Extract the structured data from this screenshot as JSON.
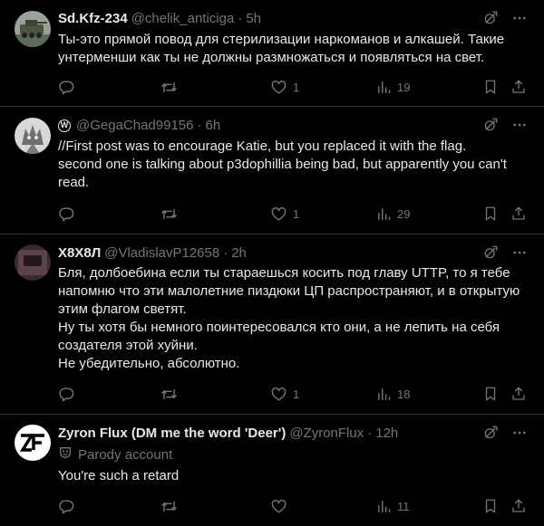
{
  "tweets": [
    {
      "username": "Sd.Kfz-234",
      "handle": "@chelik_anticiga",
      "sep": "·",
      "time": "5h",
      "text": "Ты-это прямой повод для стерилизации наркоманов и алкашей. Такие\nунтерменши как ты не должны размножаться и появляться на свет.",
      "likes": "1",
      "views": "19"
    },
    {
      "badge": "W",
      "handle": "@GegaChad99156",
      "sep": "·",
      "time": "6h",
      "text": "//First post was to encourage Katie, but you replaced it with the flag.\nsecond one is talking about p3dophillia being bad, but apparently you can't\nread.",
      "likes": "1",
      "views": "29"
    },
    {
      "username": "Х8Х8Л",
      "handle": "@VladislavP12658",
      "sep": "·",
      "time": "2h",
      "text": "Бля, долбоебина если ты стараешься косить под главу UTTP, то я тебе\nнапомню что эти малолетние пиздюки ЦП распространяют, и в открытую\nэтим флагом светят.\nНу ты хотя бы немного поинтересовался кто они, а не лепить на себя\nсоздателя этой хуйни.\nНе убедительно, абсолютно.",
      "likes": "1",
      "views": "18"
    },
    {
      "username": "Zyron Flux (DM me the word 'Deer')",
      "handle": "@ZyronFlux",
      "sep": "·",
      "time": "12h",
      "parody": "Parody account",
      "text": "You're such a retard",
      "views": "11"
    }
  ],
  "icons": {
    "grok": "grok-icon",
    "more": "more-icon",
    "reply": "reply-icon",
    "retweet": "retweet-icon",
    "like": "like-icon",
    "views": "views-icon",
    "bookmark": "bookmark-icon",
    "share": "share-icon"
  },
  "colors": {
    "background": "#000000",
    "text": "#e7e9ea",
    "muted": "#71767b",
    "divider": "#2f3336"
  }
}
